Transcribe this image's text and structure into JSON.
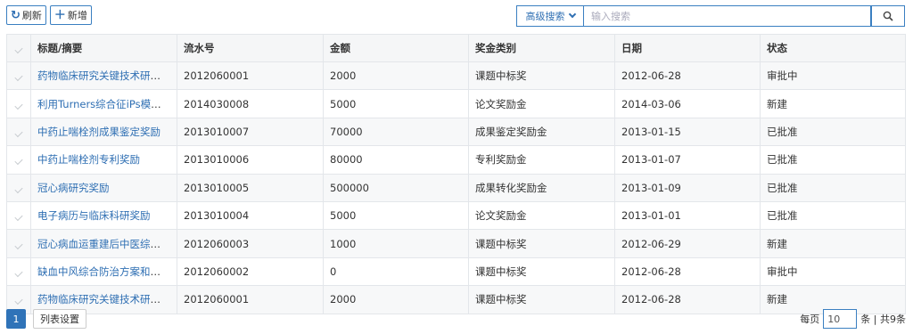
{
  "toolbar": {
    "refresh_label": "刷新",
    "add_label": "新增"
  },
  "search": {
    "advanced_label": "高级搜索",
    "placeholder": "输入搜索"
  },
  "table": {
    "columns": [
      "标题/摘要",
      "流水号",
      "金额",
      "奖金类别",
      "日期",
      "状态"
    ],
    "rows": [
      {
        "title": "药物临床研究关键技术研究与...",
        "serial": "2012060001",
        "amount": "2000",
        "category": "课题中标奖",
        "date": "2012-06-28",
        "status": "审批中"
      },
      {
        "title": "利用Turners综合征iPs模型研...",
        "serial": "2014030008",
        "amount": "5000",
        "category": "论文奖励金",
        "date": "2014-03-06",
        "status": "新建"
      },
      {
        "title": "中药止喘栓剂成果鉴定奖励",
        "serial": "2013010007",
        "amount": "70000",
        "category": "成果鉴定奖励金",
        "date": "2013-01-15",
        "status": "已批准"
      },
      {
        "title": "中药止喘栓剂专利奖励",
        "serial": "2013010006",
        "amount": "80000",
        "category": "专利奖励金",
        "date": "2013-01-07",
        "status": "已批准"
      },
      {
        "title": "冠心病研究奖励",
        "serial": "2013010005",
        "amount": "500000",
        "category": "成果转化奖励金",
        "date": "2013-01-09",
        "status": "已批准"
      },
      {
        "title": "电子病历与临床科研奖励",
        "serial": "2013010004",
        "amount": "5000",
        "category": "论文奖励金",
        "date": "2013-01-01",
        "status": "已批准"
      },
      {
        "title": "冠心病血运重建后中医综合干...",
        "serial": "2012060003",
        "amount": "1000",
        "category": "课题中标奖",
        "date": "2012-06-29",
        "status": "新建"
      },
      {
        "title": "缺血中风综合防治方案和疗效...",
        "serial": "2012060002",
        "amount": "0",
        "category": "课题中标奖",
        "date": "2012-06-28",
        "status": "审批中"
      },
      {
        "title": "药物临床研究关键技术研究与...",
        "serial": "2012060001",
        "amount": "2000",
        "category": "课题中标奖",
        "date": "2012-06-28",
        "status": "新建"
      }
    ]
  },
  "footer": {
    "current_page": "1",
    "column_settings_label": "列表设置",
    "per_page_prefix": "每页",
    "per_page_value": "10",
    "per_page_suffix": "条 | 共9条"
  },
  "colors": {
    "accent": "#2f73b8",
    "link": "#2f6fb3"
  }
}
